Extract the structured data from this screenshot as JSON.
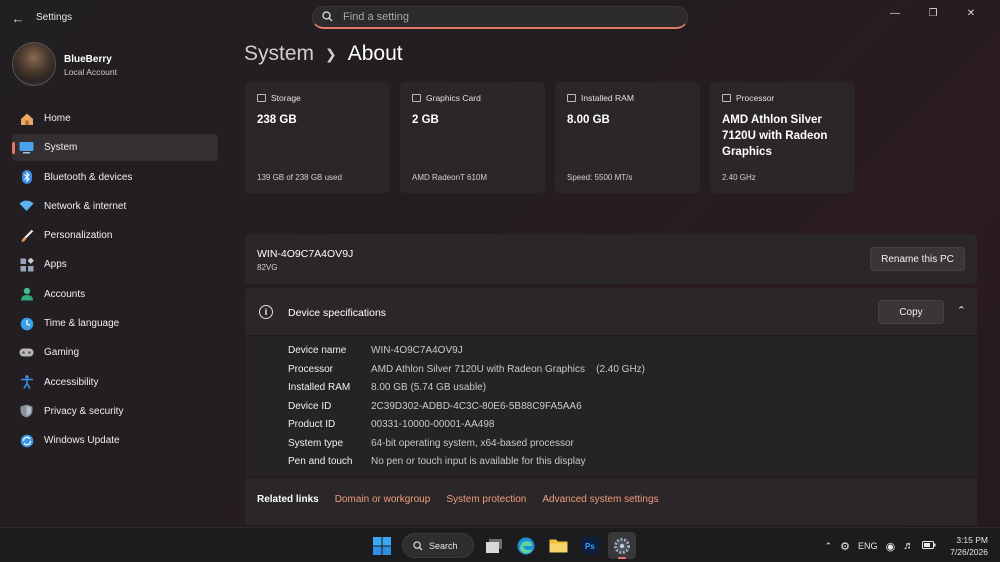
{
  "window": {
    "title": "Settings",
    "search_placeholder": "Find a setting"
  },
  "user": {
    "name": "BlueBerry",
    "account_type": "Local Account"
  },
  "sidebar": {
    "items": [
      {
        "label": "Home",
        "icon": "home-icon",
        "color": "#e8a860"
      },
      {
        "label": "System",
        "icon": "system-icon",
        "color": "#4aa3e8",
        "active": true
      },
      {
        "label": "Bluetooth & devices",
        "icon": "bluetooth-icon",
        "color": "#3a8ee6"
      },
      {
        "label": "Network & internet",
        "icon": "network-icon",
        "color": "#5bb2f0"
      },
      {
        "label": "Personalization",
        "icon": "brush-icon",
        "color": "#e89a58"
      },
      {
        "label": "Apps",
        "icon": "apps-icon",
        "color": "#9aa6b8"
      },
      {
        "label": "Accounts",
        "icon": "accounts-icon",
        "color": "#3fbf8f"
      },
      {
        "label": "Time & language",
        "icon": "time-language-icon",
        "color": "#3aa0e6"
      },
      {
        "label": "Gaming",
        "icon": "gaming-icon",
        "color": "#b8b8b8"
      },
      {
        "label": "Accessibility",
        "icon": "accessibility-icon",
        "color": "#3b8fe8"
      },
      {
        "label": "Privacy & security",
        "icon": "shield-icon",
        "color": "#8a8f99"
      },
      {
        "label": "Windows Update",
        "icon": "update-icon",
        "color": "#3a98e6"
      }
    ]
  },
  "breadcrumb": {
    "parent": "System",
    "current": "About"
  },
  "cards": [
    {
      "header": "Storage",
      "value": "238 GB",
      "footer": "139 GB of 238 GB used"
    },
    {
      "header": "Graphics Card",
      "value": "2 GB",
      "footer": "AMD RadeonT 610M"
    },
    {
      "header": "Installed RAM",
      "value": "8.00 GB",
      "footer": "Speed: 5500 MT/s"
    },
    {
      "header": "Processor",
      "value": "AMD Athlon Silver 7120U with Radeon Graphics",
      "footer": "2.40 GHz"
    }
  ],
  "pc": {
    "name": "WIN-4O9C7A4OV9J",
    "model": "82VG",
    "rename_label": "Rename this PC"
  },
  "device_specs": {
    "title": "Device specifications",
    "copy_label": "Copy",
    "rows": [
      {
        "key": "Device name",
        "value": "WIN-4O9C7A4OV9J"
      },
      {
        "key": "Processor",
        "value": "AMD Athlon Silver 7120U with Radeon Graphics    (2.40 GHz)"
      },
      {
        "key": "Installed RAM",
        "value": "8.00 GB (5.74 GB usable)"
      },
      {
        "key": "Device ID",
        "value": "2C39D302-ADBD-4C3C-80E6-5B88C9FA5AA6"
      },
      {
        "key": "Product ID",
        "value": "00331-10000-00001-AA498"
      },
      {
        "key": "System type",
        "value": "64-bit operating system, x64-based processor"
      },
      {
        "key": "Pen and touch",
        "value": "No pen or touch input is available for this display"
      }
    ]
  },
  "related_links": {
    "label": "Related links",
    "links": [
      "Domain or workgroup",
      "System protection",
      "Advanced system settings"
    ]
  },
  "taskbar": {
    "search_label": "Search",
    "language": "ENG",
    "time": "3:15 PM",
    "date": "7/26/2026"
  }
}
